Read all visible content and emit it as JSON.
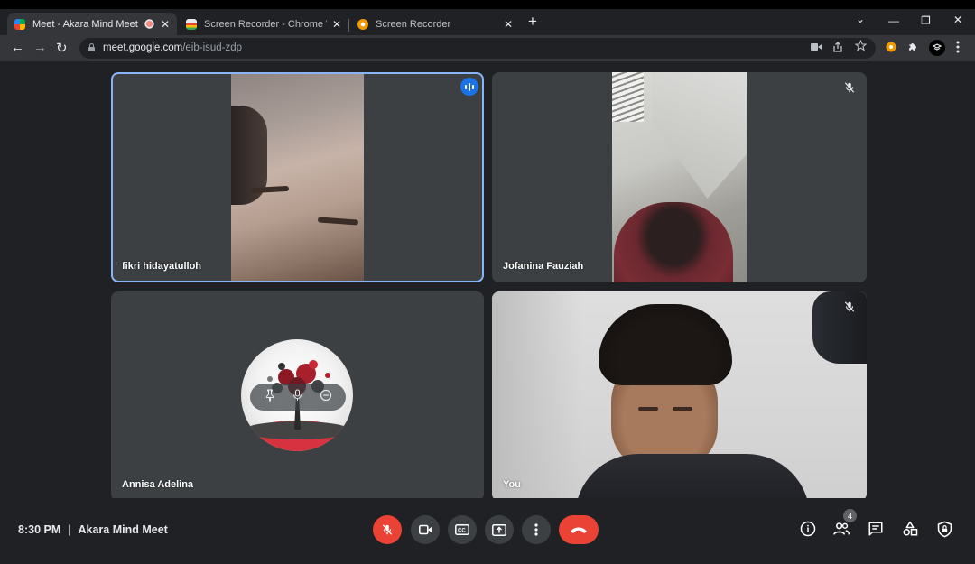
{
  "browser": {
    "tabs": [
      {
        "title": "Meet - Akara Mind Meet",
        "active": true,
        "recording": true
      },
      {
        "title": "Screen Recorder - Chrome Web Store",
        "active": false
      },
      {
        "title": "Screen Recorder",
        "active": false
      }
    ],
    "newtab_label": "+",
    "close_glyph": "✕",
    "window_controls": {
      "dropdown": "⌄",
      "minimize": "—",
      "restore": "❐",
      "close": "✕"
    },
    "nav": {
      "back": "←",
      "forward": "→",
      "reload": "↻"
    },
    "url": {
      "host": "meet.google.com",
      "path": "/eib-isud-zdp"
    },
    "omnibox_icons": [
      "camera-icon",
      "share-icon",
      "star-icon"
    ],
    "extension_icons": [
      "screen-recorder-extension-icon",
      "puzzle-extensions-icon",
      "profile-avatar-icon",
      "kebab-menu-icon"
    ],
    "colors": {
      "tabbar": "#202124",
      "toolbar": "#35363a"
    }
  },
  "meet": {
    "participants": [
      {
        "name": "fikri hidayatulloh",
        "speaking": true,
        "muted": false,
        "video": true
      },
      {
        "name": "Jofanina Fauziah",
        "speaking": false,
        "muted": true,
        "video": true
      },
      {
        "name": "Annisa Adelina",
        "speaking": false,
        "muted": false,
        "video": false
      },
      {
        "name": "You",
        "speaking": false,
        "muted": true,
        "video": true
      }
    ],
    "tile_hover_icons": [
      "pin-icon",
      "mic-icon",
      "remove-icon"
    ],
    "time": "8:30 PM",
    "separator": "|",
    "meeting_name": "Akara Mind Meet",
    "controls": [
      "mic-off-icon",
      "camera-icon",
      "captions-icon",
      "present-screen-icon",
      "more-options-icon",
      "end-call-icon"
    ],
    "side_controls": [
      "info-icon",
      "people-icon",
      "chat-icon",
      "activities-icon",
      "host-controls-icon"
    ],
    "people_count": "4",
    "colors": {
      "speaking_border": "#8ab4f8",
      "end_call": "#ea4335",
      "tile_bg": "#3c4043",
      "background": "#202124"
    }
  }
}
